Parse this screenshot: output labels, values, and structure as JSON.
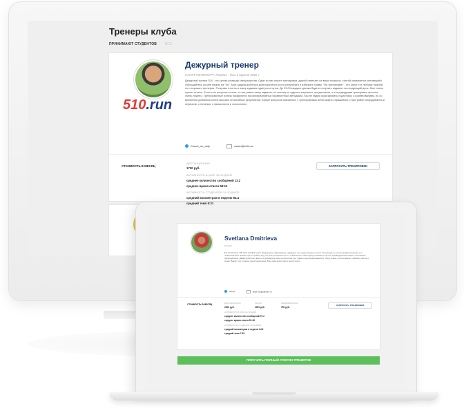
{
  "desktop": {
    "page_title": "Тренеры клуба",
    "tabs": [
      "ПРИНИМАЮТ СТУДЕНТОВ",
      "ВСЕ"
    ],
    "coach": {
      "logo_text_num": "510",
      "logo_text_tail": ".run",
      "name": "Дежурный тренер",
      "location": "САНКТ-ПЕТЕРБУРГ, RUSSIA · был 3 апреля 2020 г.",
      "bio": "Дежурный тренер S10 - это целая команда специалистов. Один из нас пишет тренировки, другой отвечает на ваши вопросы, третий занимается мотивацией. Обращайтесь ко мне можно на \"ты\". Моя задача добиться долгосрочного роста результата и избежать травм. \"На тренировке\" - это залог тут любому нужной, но и хороших тренеров. Я изучаю отчеты и пишу задания один раз в сутки. До 23:00 каждого дня вы будете получать задание на следующий день. Мне очень нужны отчеты. Если я не получаю отчета, то все равно пишу задание, но исхожу из худшего варианта, предполагая, что предыдущая тренировка прошла очень тяжело. Тренировочные планы базируются на консервативных проверенных методиках. Мы не будем форсировать подготовку к соревнованиям, но со временем добьемся очень высоких спортивных результатов. Кроме вопросов связанных с тренировками меня можно спрашивать о настройке оборудования и сервисов, о питании, о физиологии и психологии.",
      "telegram": "Coach_on_duty",
      "email": "coach@s10.run",
      "price_label": "СТОИМОСТЬ В МЕСЯЦ",
      "duration_label": "ДИСТАНЦИОННО",
      "price": "1700 руб.",
      "activity_label": "АКТИВНОСТЬ В ЧАТЕ ЗА 30 ДНЕЙ",
      "avg_messages": "среднее количество сообщений 13.2",
      "avg_response": "среднее время ответа 58:12",
      "students_activity_label": "АКТИВНОСТЬ СТУДЕНТОВ ЗА 30 ДНЕЙ",
      "avg_km": "средний километраж в неделю 64.4",
      "avg_pace": "средний темп 6:31",
      "request_button": "ЗАПРОСИТЬ ТРЕНИРОВКИ"
    }
  },
  "laptop": {
    "coach": {
      "name": "Svetlana Dmitrieva",
      "location": "RUSSIA",
      "bio": "Бег без Ритмов / PB 3.26. Certified coach. Медицинское образование и двадцать лет педагогического опыта. Я тренирую не только профессионалов, но и любителей бега. Люблю горы и трейлы. Ищу тех, кому интересен рост и стабильность. Мой подход основан на тестах, индивидуальном плане и постоянной обратной связи. Давайте работать вместе и добиваться новых результатов, без травм и перетренированности. Пишу планы с учетом вашего графика, работы и семьи. Важно: сон, питание и восстановление. Буду рада видеть вас в своей группе.",
      "telegram": "otrmyf",
      "email": "lasyf.run@yandex.ru",
      "price_label": "СТОИМОСТЬ В МЕСЯЦ",
      "col1_label": "ДИСТАНЦИОННО",
      "col1_price": "2000 руб.",
      "col2_label": "ЛИЧНО",
      "col2_price": "4000 руб.",
      "col3_label": "ИНДИВИДУАЛЬНО",
      "col3_price": "750 руб.",
      "activity_label": "АКТИВНОСТЬ В ЧАТЕ ЗА 30 ДНЕЙ",
      "avg_messages": "среднее количество сообщений 79.2",
      "avg_response": "среднее время ответа 51:26",
      "students_activity_label": "АКТИВНОСТЬ СТУДЕНТОВ ЗА 30 ДНЕЙ",
      "avg_km": "средний километраж в неделю 34.3",
      "avg_pace": "средний темп 7:35",
      "request_button": "ЗАПРОСИТЬ ТРЕНИРОВКИ"
    },
    "full_list_button": "ПОЛУЧИТЬ ПОЛНЫЙ СПИСОК ТРЕНЕРОВ"
  }
}
